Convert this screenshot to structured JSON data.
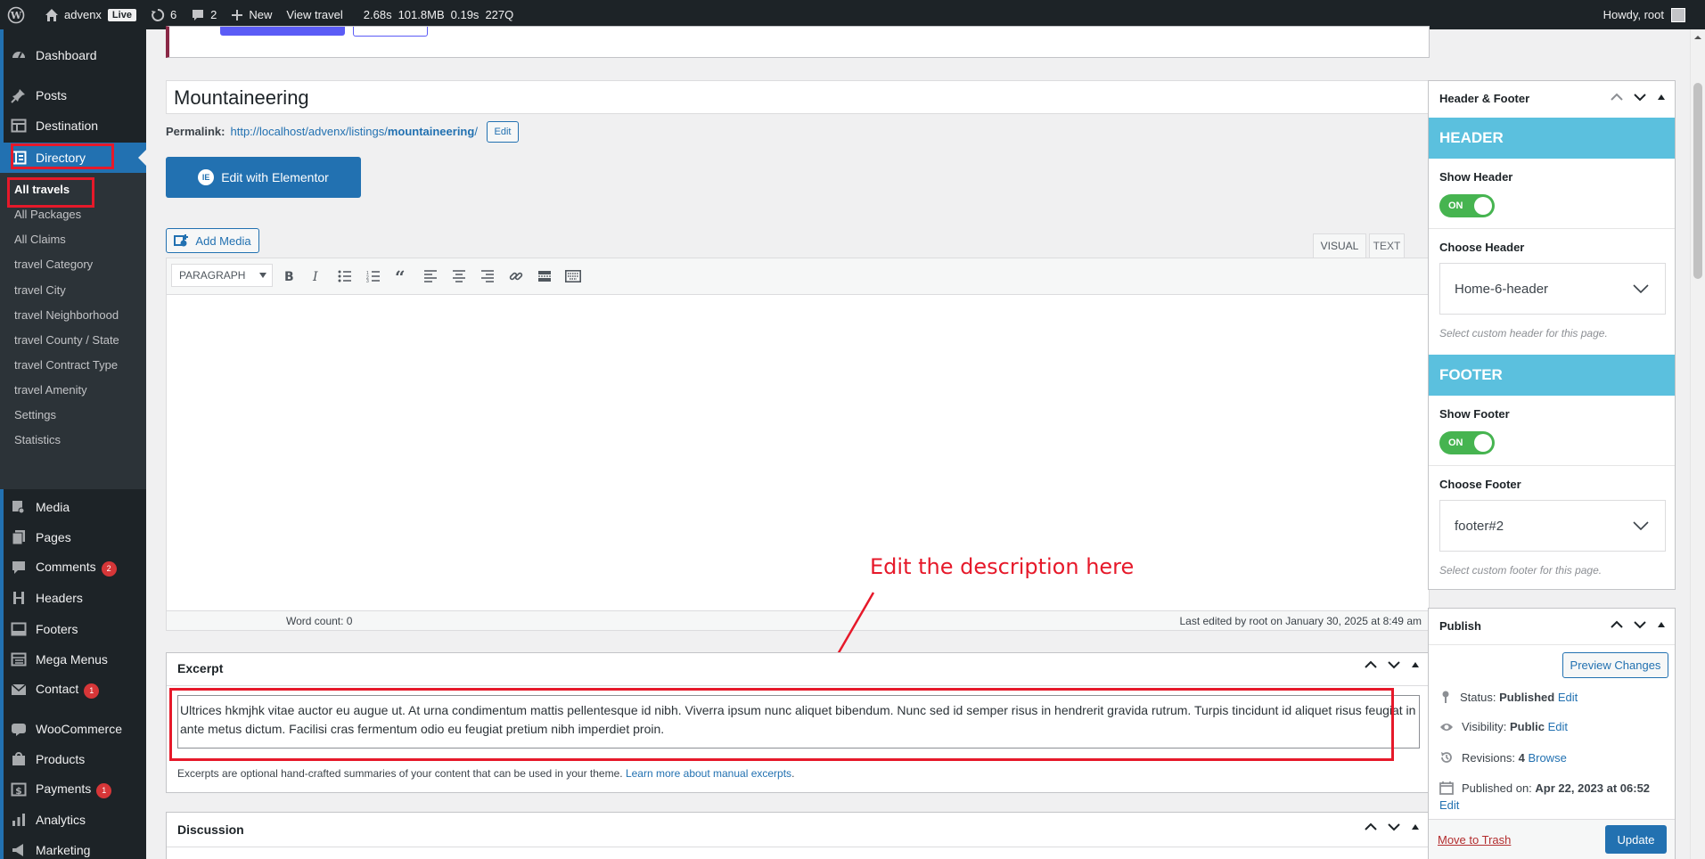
{
  "adminbar": {
    "site_name": "advenx",
    "live": "Live",
    "updates": "6",
    "comments": "2",
    "new": "New",
    "view": "View travel",
    "metrics": [
      "2.68s",
      "101.8MB",
      "0.19s",
      "227Q"
    ],
    "howdy": "Howdy, root"
  },
  "sidebar": {
    "items": [
      {
        "label": "Dashboard",
        "icon": "dashboard-icon"
      },
      {
        "label": "Posts",
        "icon": "pin-icon"
      },
      {
        "label": "Destination",
        "icon": "table-icon"
      },
      {
        "label": "Directory",
        "icon": "directory-icon"
      },
      {
        "label": "Media",
        "icon": "media-icon"
      },
      {
        "label": "Pages",
        "icon": "pages-icon"
      },
      {
        "label": "Comments",
        "icon": "comments-icon",
        "badge": "2"
      },
      {
        "label": "Headers",
        "icon": "header-icon"
      },
      {
        "label": "Footers",
        "icon": "footer-icon"
      },
      {
        "label": "Mega Menus",
        "icon": "menu-icon"
      },
      {
        "label": "Contact",
        "icon": "mail-icon",
        "badge": "1"
      },
      {
        "label": "WooCommerce",
        "icon": "woo-icon"
      },
      {
        "label": "Products",
        "icon": "products-icon"
      },
      {
        "label": "Payments",
        "icon": "payments-icon",
        "badge": "1"
      },
      {
        "label": "Analytics",
        "icon": "analytics-icon"
      },
      {
        "label": "Marketing",
        "icon": "marketing-icon"
      }
    ],
    "submenu": [
      "All travels",
      "All Packages",
      "All Claims",
      "travel Category",
      "travel City",
      "travel Neighborhood",
      "travel County / State",
      "travel Contract Type",
      "travel Amenity",
      "Settings",
      "Statistics"
    ]
  },
  "editor": {
    "title": "Mountaineering",
    "permalink_label": "Permalink:",
    "permalink_base": "http://localhost/advenx/listings/",
    "permalink_slug": "mountaineering",
    "permalink_end": "/",
    "edit_btn": "Edit",
    "elementor_btn": "Edit with Elementor",
    "add_media": "Add Media",
    "tab_visual": "VISUAL",
    "tab_text": "TEXT",
    "format_select": "PARAGRAPH",
    "word_count": "Word count: 0",
    "last_edited": "Last edited by root on January 30, 2025 at 8:49 am"
  },
  "annotation": {
    "text": "Edit the description here",
    "color": "#e6192a"
  },
  "excerpt": {
    "title": "Excerpt",
    "text": "Ultrices hkmjhk vitae auctor eu augue ut. At urna condimentum mattis pellentesque id nibh. Viverra ipsum nunc aliquet bibendum. Nunc sed id semper risus in hendrerit gravida rutrum. Turpis tincidunt id aliquet risus feugiat in ante metus dictum. Facilisi cras fermentum odio eu feugiat pretium nibh imperdiet proin.",
    "help": "Excerpts are optional hand-crafted summaries of your content that can be used in your theme.",
    "help_link": "Learn more about manual excerpts",
    "help_end": "."
  },
  "discussion": {
    "title": "Discussion"
  },
  "header_footer": {
    "title": "Header & Footer",
    "header_band": "HEADER",
    "show_header": "Show Header",
    "toggle_on": "ON",
    "choose_header": "Choose Header",
    "header_value": "Home-6-header",
    "header_hint": "Select custom header for this page.",
    "footer_band": "FOOTER",
    "show_footer": "Show Footer",
    "choose_footer": "Choose Footer",
    "footer_value": "footer#2",
    "footer_hint": "Select custom footer for this page.",
    "band_color": "#5bc0de",
    "toggle_color": "#46b450"
  },
  "publish": {
    "title": "Publish",
    "preview": "Preview Changes",
    "status_label": "Status:",
    "status_value": "Published",
    "visibility_label": "Visibility:",
    "visibility_value": "Public",
    "revisions_label": "Revisions:",
    "revisions_value": "4",
    "browse": "Browse",
    "published_label": "Published on:",
    "published_value": "Apr 22, 2023 at 06:52",
    "edit": "Edit",
    "trash": "Move to Trash",
    "update": "Update"
  }
}
